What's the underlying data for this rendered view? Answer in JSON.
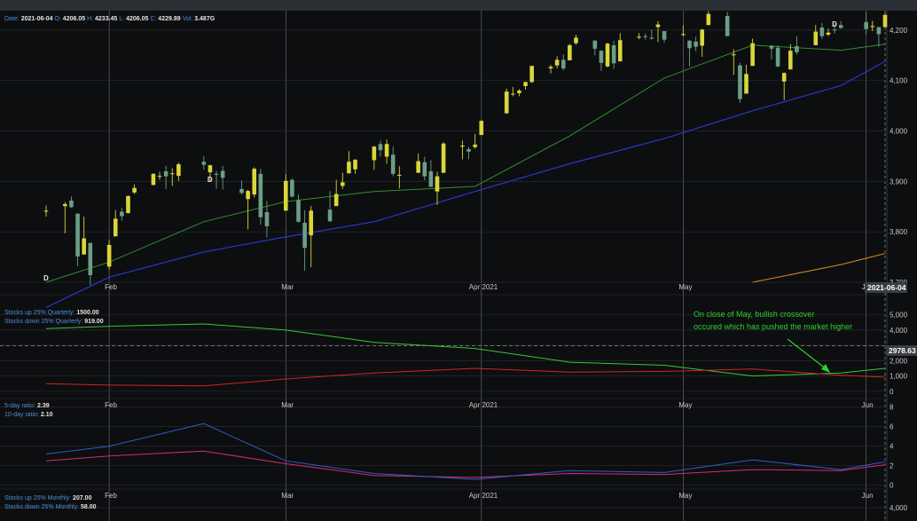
{
  "header": {
    "date_label": "Date:",
    "date": "2021-06-04",
    "open_label": "O:",
    "open": "4206.05",
    "high_label": "H:",
    "high": "4233.45",
    "low_label": "L:",
    "low": "4206.05",
    "close_label": "C:",
    "close": "4229.89",
    "vol_label": "Vol:",
    "vol": "3.487G"
  },
  "colors": {
    "background": "#0d0e10",
    "grid": "#262a31",
    "up": "#d9d63a",
    "down": "#6b9e86",
    "ma_short": "#2f8f2f",
    "ma_mid": "#2b36c9",
    "ma_long": "#d98a1e",
    "quarterly_up": "#35c735",
    "quarterly_down": "#d02424",
    "ratio5": "#2f5ec9",
    "ratio10": "#d32a7c",
    "annotation": "#2fd12f",
    "legend_label": "#4d8fd6"
  },
  "x_months": [
    {
      "label": "Feb",
      "date": "2021-02-01"
    },
    {
      "label": "Mar",
      "date": "2021-03-01"
    },
    {
      "label": "Apr 2021",
      "date": "2021-04-01"
    },
    {
      "label": "May",
      "date": "2021-05-03"
    },
    {
      "label": "Jun",
      "date": "2021-06-01"
    }
  ],
  "cursor_date": "2021-06-04",
  "price_panel": {
    "yticks": [
      "3,700",
      "3,800",
      "3,900",
      "4,000",
      "4,100",
      "4,200"
    ],
    "dividend_marker": "D"
  },
  "breadth_panel": {
    "legend": [
      {
        "label": "Stocks up 25% Quarterly:",
        "value": "1500.00"
      },
      {
        "label": "Stocks down 25% Quarterly:",
        "value": "919.00"
      }
    ],
    "yticks": [
      "0",
      "1,000",
      "2,000",
      "3,000",
      "4,000",
      "5,000"
    ],
    "reference_value": "2978.63",
    "annotation_line1": "On close of May, bullish crossover",
    "annotation_line2": "occured which has pushed the market higher"
  },
  "ratio_panel": {
    "legend": [
      {
        "label": "5-day ratio:",
        "value": "2.39"
      },
      {
        "label": "10-day ratio:",
        "value": "2.10"
      }
    ],
    "yticks": [
      "0",
      "2",
      "4",
      "6",
      "8"
    ]
  },
  "monthly_panel": {
    "legend": [
      {
        "label": "Stocks up 25% Monthly:",
        "value": "207.00"
      },
      {
        "label": "Stocks down 25% Monthly:",
        "value": "58.00"
      }
    ],
    "yticks": [
      "4,000"
    ]
  },
  "chart_data": [
    {
      "type": "candlestick",
      "title": "",
      "x_range": [
        "2021-01-22",
        "2021-06-04"
      ],
      "ylim": [
        3700,
        4235
      ],
      "candles": [
        [
          "2021-01-22",
          3840,
          3852,
          3830,
          3842
        ],
        [
          "2021-01-25",
          3851,
          3859,
          3797,
          3855
        ],
        [
          "2021-01-26",
          3862,
          3870,
          3847,
          3849
        ],
        [
          "2021-01-27",
          3836,
          3836,
          3732,
          3751
        ],
        [
          "2021-01-28",
          3755,
          3830,
          3755,
          3787
        ],
        [
          "2021-01-29",
          3778,
          3778,
          3694,
          3714
        ],
        [
          "2021-02-01",
          3731,
          3784,
          3725,
          3774
        ],
        [
          "2021-02-02",
          3791,
          3843,
          3791,
          3826
        ],
        [
          "2021-02-03",
          3840,
          3848,
          3822,
          3831
        ],
        [
          "2021-02-04",
          3837,
          3872,
          3837,
          3871
        ],
        [
          "2021-02-05",
          3878,
          3894,
          3875,
          3887
        ],
        [
          "2021-02-08",
          3893,
          3916,
          3892,
          3915
        ],
        [
          "2021-02-09",
          3910,
          3919,
          3903,
          3911
        ],
        [
          "2021-02-10",
          3920,
          3931,
          3885,
          3910
        ],
        [
          "2021-02-11",
          3916,
          3926,
          3891,
          3916
        ],
        [
          "2021-02-12",
          3911,
          3937,
          3901,
          3934
        ],
        [
          "2021-02-16",
          3939,
          3950,
          3923,
          3933
        ],
        [
          "2021-02-17",
          3918,
          3933,
          3900,
          3932
        ],
        [
          "2021-02-18",
          3915,
          3921,
          3885,
          3913
        ],
        [
          "2021-02-19",
          3921,
          3931,
          3884,
          3907
        ],
        [
          "2021-02-22",
          3885,
          3902,
          3874,
          3877
        ],
        [
          "2021-02-23",
          3865,
          3883,
          3805,
          3881
        ],
        [
          "2021-02-24",
          3874,
          3928,
          3868,
          3925
        ],
        [
          "2021-02-25",
          3915,
          3925,
          3814,
          3829
        ],
        [
          "2021-02-26",
          3839,
          3861,
          3789,
          3811
        ],
        [
          "2021-03-01",
          3842,
          3914,
          3842,
          3901
        ],
        [
          "2021-03-02",
          3903,
          3906,
          3868,
          3870
        ],
        [
          "2021-03-03",
          3863,
          3874,
          3818,
          3820
        ],
        [
          "2021-03-04",
          3818,
          3843,
          3723,
          3768
        ],
        [
          "2021-03-05",
          3793,
          3851,
          3730,
          3842
        ],
        [
          "2021-03-08",
          3844,
          3881,
          3819,
          3821
        ],
        [
          "2021-03-09",
          3851,
          3903,
          3851,
          3875
        ],
        [
          "2021-03-10",
          3891,
          3917,
          3885,
          3898
        ],
        [
          "2021-03-11",
          3916,
          3960,
          3916,
          3939
        ],
        [
          "2021-03-12",
          3924,
          3944,
          3915,
          3943
        ],
        [
          "2021-03-15",
          3942,
          3970,
          3923,
          3969
        ],
        [
          "2021-03-16",
          3974,
          3981,
          3949,
          3962
        ],
        [
          "2021-03-17",
          3949,
          3983,
          3935,
          3974
        ],
        [
          "2021-03-18",
          3953,
          3969,
          3910,
          3915
        ],
        [
          "2021-03-19",
          3913,
          3930,
          3886,
          3913
        ],
        [
          "2021-03-22",
          3917,
          3955,
          3917,
          3940
        ],
        [
          "2021-03-23",
          3938,
          3949,
          3902,
          3910
        ],
        [
          "2021-03-24",
          3920,
          3942,
          3889,
          3889
        ],
        [
          "2021-03-25",
          3880,
          3919,
          3853,
          3910
        ],
        [
          "2021-03-26",
          3917,
          3978,
          3917,
          3975
        ],
        [
          "2021-03-29",
          3969,
          3981,
          3944,
          3971
        ],
        [
          "2021-03-30",
          3964,
          3968,
          3944,
          3959
        ],
        [
          "2021-03-31",
          3968,
          3994,
          3965,
          3973
        ],
        [
          "2021-04-01",
          3992,
          4021,
          3992,
          4020
        ],
        [
          "2021-04-05",
          4035,
          4084,
          4034,
          4078
        ],
        [
          "2021-04-06",
          4074,
          4087,
          4069,
          4074
        ],
        [
          "2021-04-07",
          4075,
          4083,
          4069,
          4080
        ],
        [
          "2021-04-08",
          4089,
          4098,
          4082,
          4097
        ],
        [
          "2021-04-09",
          4097,
          4129,
          4095,
          4129
        ],
        [
          "2021-04-12",
          4124,
          4131,
          4114,
          4127
        ],
        [
          "2021-04-13",
          4130,
          4148,
          4124,
          4141
        ],
        [
          "2021-04-14",
          4141,
          4152,
          4120,
          4124
        ],
        [
          "2021-04-15",
          4140,
          4173,
          4140,
          4170
        ],
        [
          "2021-04-16",
          4174,
          4191,
          4171,
          4185
        ],
        [
          "2021-04-19",
          4179,
          4180,
          4150,
          4163
        ],
        [
          "2021-04-20",
          4159,
          4160,
          4119,
          4135
        ],
        [
          "2021-04-21",
          4128,
          4175,
          4126,
          4173
        ],
        [
          "2021-04-22",
          4170,
          4179,
          4123,
          4134
        ],
        [
          "2021-04-23",
          4138,
          4194,
          4138,
          4180
        ],
        [
          "2021-04-26",
          4185,
          4194,
          4182,
          4187
        ],
        [
          "2021-04-27",
          4188,
          4193,
          4181,
          4187
        ],
        [
          "2021-04-28",
          4185,
          4201,
          4181,
          4183
        ],
        [
          "2021-04-29",
          4206,
          4218,
          4176,
          4211
        ],
        [
          "2021-04-30",
          4198,
          4198,
          4175,
          4181
        ],
        [
          "2021-05-03",
          4191,
          4209,
          4188,
          4192
        ],
        [
          "2021-05-04",
          4179,
          4180,
          4128,
          4164
        ],
        [
          "2021-05-05",
          4177,
          4187,
          4158,
          4167
        ],
        [
          "2021-05-06",
          4169,
          4202,
          4147,
          4201
        ],
        [
          "2021-05-07",
          4210,
          4238,
          4210,
          4232
        ],
        [
          "2021-05-10",
          4228,
          4236,
          4188,
          4188
        ],
        [
          "2021-05-11",
          4150,
          4162,
          4111,
          4152
        ],
        [
          "2021-05-12",
          4130,
          4135,
          4056,
          4063
        ],
        [
          "2021-05-13",
          4074,
          4131,
          4074,
          4113
        ],
        [
          "2021-05-14",
          4129,
          4183,
          4129,
          4174
        ],
        [
          "2021-05-17",
          4169,
          4170,
          4142,
          4163
        ],
        [
          "2021-05-18",
          4165,
          4170,
          4126,
          4128
        ],
        [
          "2021-05-19",
          4098,
          4116,
          4061,
          4115
        ],
        [
          "2021-05-20",
          4122,
          4172,
          4122,
          4159
        ],
        [
          "2021-05-21",
          4168,
          4188,
          4151,
          4156
        ],
        [
          "2021-05-24",
          4170,
          4210,
          4170,
          4197
        ],
        [
          "2021-05-25",
          4205,
          4214,
          4182,
          4188
        ],
        [
          "2021-05-26",
          4191,
          4203,
          4188,
          4195
        ],
        [
          "2021-05-27",
          4201,
          4213,
          4193,
          4200
        ],
        [
          "2021-05-28",
          4210,
          4218,
          4203,
          4204
        ],
        [
          "2021-06-01",
          4216,
          4235,
          4191,
          4202
        ],
        [
          "2021-06-02",
          4206,
          4218,
          4198,
          4208
        ],
        [
          "2021-06-03",
          4206,
          4206,
          4167,
          4192
        ],
        [
          "2021-06-04",
          4206,
          4233,
          4206,
          4230
        ]
      ],
      "ma_short": [
        [
          "2021-01-22",
          3700
        ],
        [
          "2021-02-01",
          3740
        ],
        [
          "2021-02-16",
          3820
        ],
        [
          "2021-03-01",
          3860
        ],
        [
          "2021-03-15",
          3880
        ],
        [
          "2021-03-31",
          3890
        ],
        [
          "2021-04-15",
          3990
        ],
        [
          "2021-04-30",
          4105
        ],
        [
          "2021-05-14",
          4170
        ],
        [
          "2021-05-28",
          4160
        ],
        [
          "2021-06-04",
          4172
        ]
      ],
      "ma_mid": [
        [
          "2021-01-22",
          3650
        ],
        [
          "2021-02-01",
          3710
        ],
        [
          "2021-02-16",
          3760
        ],
        [
          "2021-03-01",
          3790
        ],
        [
          "2021-03-15",
          3820
        ],
        [
          "2021-03-31",
          3880
        ],
        [
          "2021-04-15",
          3935
        ],
        [
          "2021-04-30",
          3985
        ],
        [
          "2021-05-14",
          4040
        ],
        [
          "2021-05-28",
          4090
        ],
        [
          "2021-06-04",
          4138
        ]
      ],
      "ma_long": [
        [
          "2021-05-14",
          3700
        ],
        [
          "2021-05-28",
          3735
        ],
        [
          "2021-06-04",
          3757
        ]
      ]
    },
    {
      "type": "line",
      "title": "",
      "ylim": [
        -300,
        6200
      ],
      "x": [
        "2021-01-22",
        "2021-02-01",
        "2021-02-16",
        "2021-03-01",
        "2021-03-15",
        "2021-03-31",
        "2021-04-15",
        "2021-04-30",
        "2021-05-14",
        "2021-05-28",
        "2021-06-04"
      ],
      "series": [
        {
          "name": "Stocks up 25% Quarterly",
          "values": [
            4100,
            4250,
            4400,
            4000,
            3200,
            2800,
            1900,
            1700,
            1000,
            1200,
            1500
          ]
        },
        {
          "name": "Stocks down 25% Quarterly",
          "values": [
            500,
            400,
            350,
            800,
            1200,
            1500,
            1250,
            1300,
            1450,
            1050,
            919
          ]
        }
      ]
    },
    {
      "type": "line",
      "title": "",
      "ylim": [
        -0.3,
        8.6
      ],
      "x": [
        "2021-01-22",
        "2021-02-01",
        "2021-02-16",
        "2021-03-01",
        "2021-03-15",
        "2021-03-31",
        "2021-04-15",
        "2021-04-30",
        "2021-05-14",
        "2021-05-28",
        "2021-06-04"
      ],
      "series": [
        {
          "name": "5-day ratio",
          "values": [
            3.2,
            4.0,
            6.3,
            2.5,
            1.2,
            0.6,
            1.5,
            1.3,
            2.6,
            1.6,
            2.39
          ]
        },
        {
          "name": "10-day ratio",
          "values": [
            2.5,
            3.0,
            3.5,
            2.2,
            1.0,
            0.8,
            1.2,
            1.1,
            1.6,
            1.5,
            2.1
          ]
        }
      ]
    }
  ]
}
